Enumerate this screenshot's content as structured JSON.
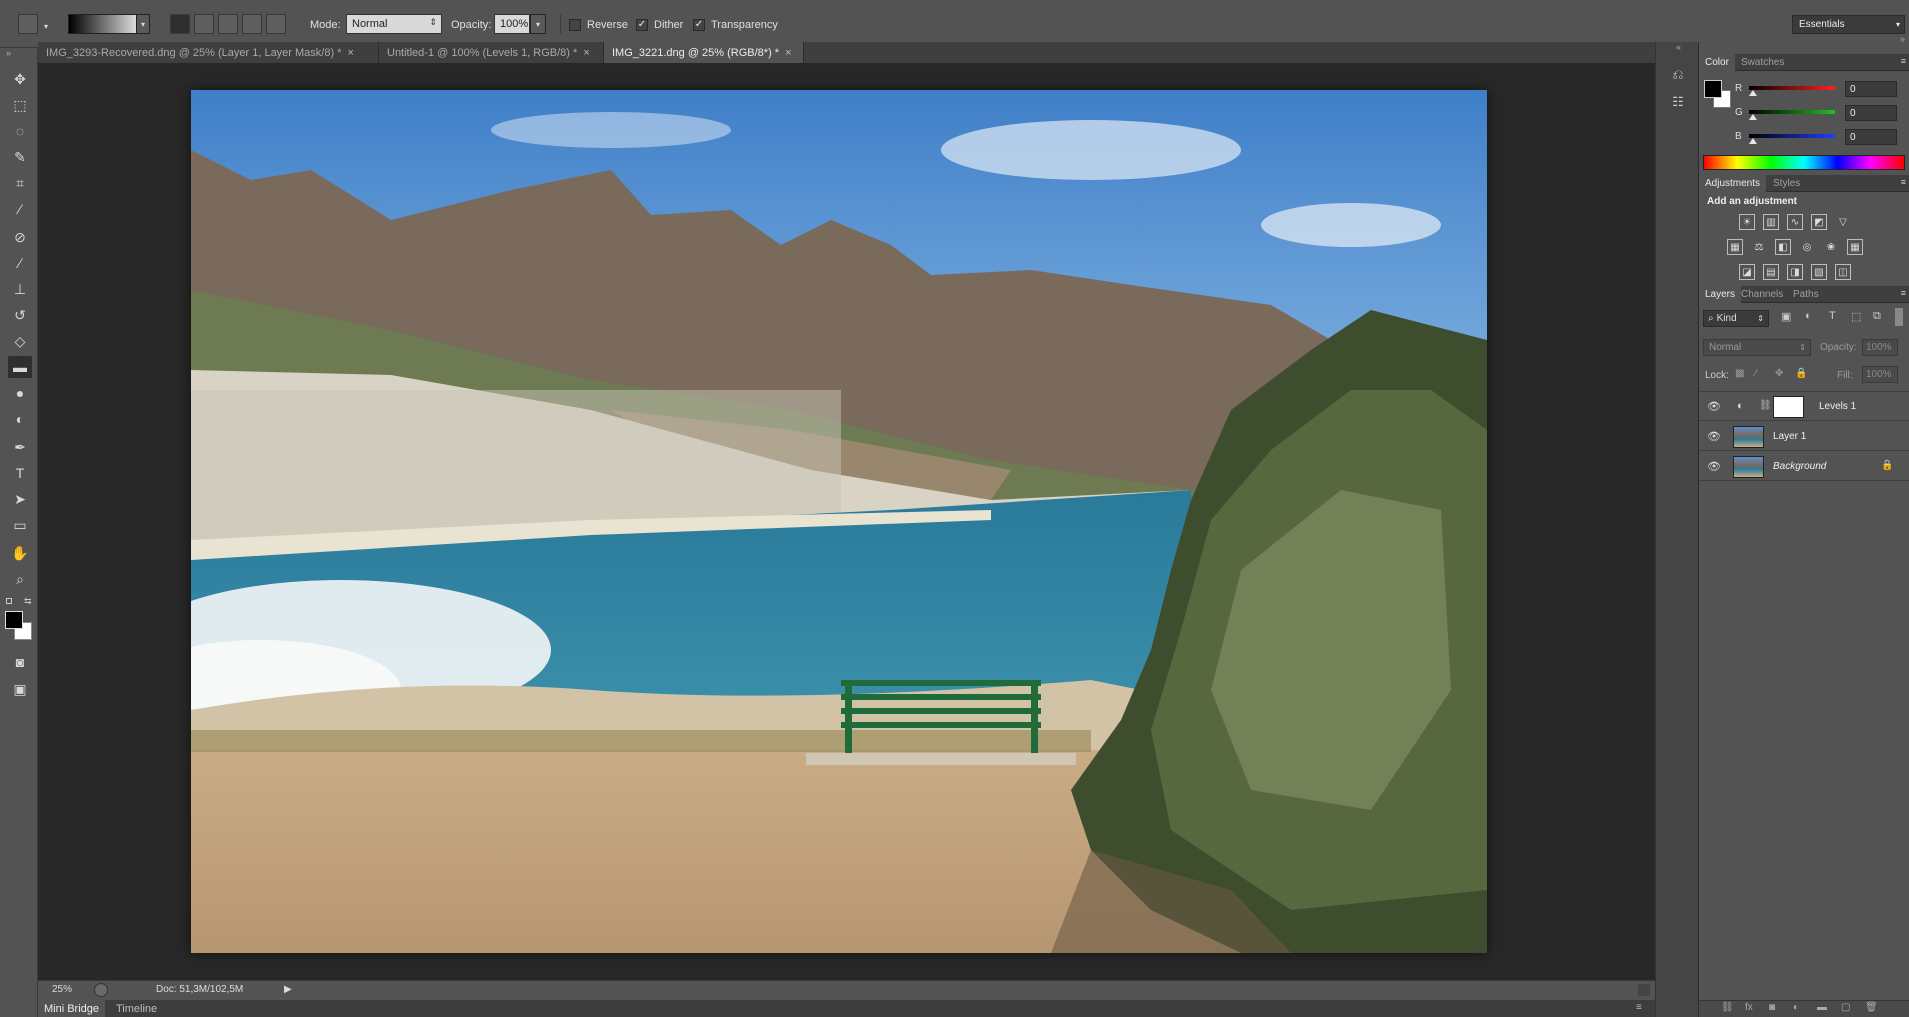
{
  "options_bar": {
    "mode_label": "Mode:",
    "mode_value": "Normal",
    "opacity_label": "Opacity:",
    "opacity_value": "100%",
    "reverse_label": "Reverse",
    "reverse_checked": false,
    "dither_label": "Dither",
    "dither_checked": true,
    "transparency_label": "Transparency",
    "transparency_checked": true,
    "workspace": "Essentials"
  },
  "doc_tabs": [
    {
      "label": "IMG_3293-Recovered.dng @ 25% (Layer 1, Layer Mask/8) *",
      "active": false
    },
    {
      "label": "Untitled-1 @ 100% (Levels 1, RGB/8) *",
      "active": false
    },
    {
      "label": "IMG_3221.dng @ 25% (RGB/8*) *",
      "active": true
    }
  ],
  "close_glyph": "×",
  "status": {
    "zoom": "25%",
    "doc": "Doc: 51,3M/102,5M"
  },
  "bottom_tabs": [
    "Mini Bridge",
    "Timeline"
  ],
  "color_panel": {
    "tabs": [
      "Color",
      "Swatches"
    ],
    "channels": [
      {
        "label": "R",
        "value": "0",
        "color": "#ff2020"
      },
      {
        "label": "G",
        "value": "0",
        "color": "#20c020"
      },
      {
        "label": "B",
        "value": "0",
        "color": "#2040ff"
      }
    ]
  },
  "adjustments_panel": {
    "tabs": [
      "Adjustments",
      "Styles"
    ],
    "heading": "Add an adjustment"
  },
  "layers_panel": {
    "tabs": [
      "Layers",
      "Channels",
      "Paths"
    ],
    "filter_kind": "Kind",
    "blend_mode": "Normal",
    "opacity_label": "Opacity:",
    "opacity_value": "100%",
    "lock_label": "Lock:",
    "fill_label": "Fill:",
    "fill_value": "100%",
    "layers": [
      {
        "name": "Levels 1",
        "type": "adjustment"
      },
      {
        "name": "Layer 1",
        "type": "pixel"
      },
      {
        "name": "Background",
        "type": "background"
      }
    ]
  },
  "colors": {
    "panel_bg": "#535353",
    "canvas_bg": "#282828",
    "accent_selected": "#2f2f2f"
  }
}
